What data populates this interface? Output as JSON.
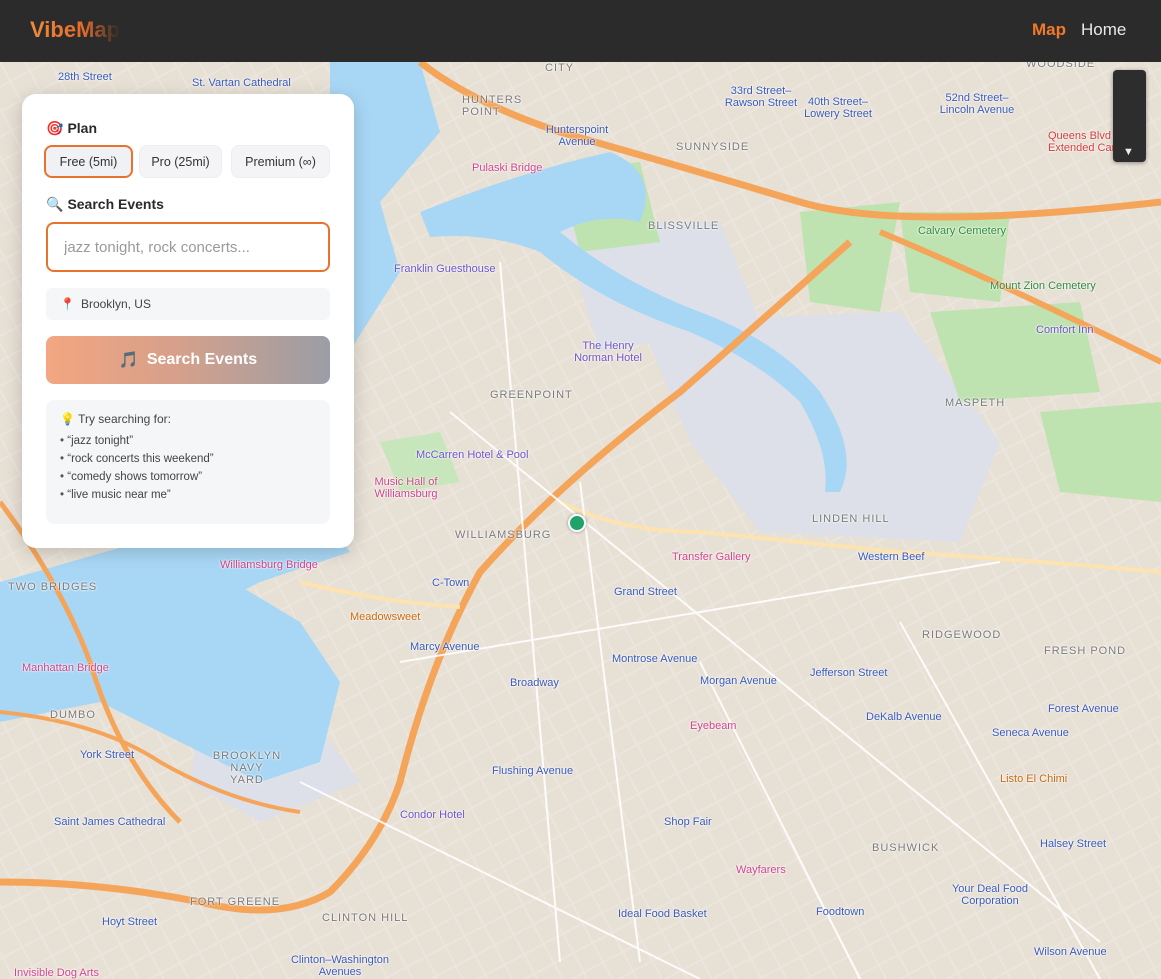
{
  "header": {
    "logo": "VibeMap",
    "nav": [
      {
        "label": "Map",
        "active": true
      },
      {
        "label": "Home",
        "active": false
      }
    ]
  },
  "panel": {
    "plan_title": "Plan",
    "plan_icon": "🎯",
    "plans": [
      {
        "label": "Free (5mi)",
        "selected": true
      },
      {
        "label": "Pro (25mi)",
        "selected": false
      },
      {
        "label": "Premium (∞)",
        "selected": false
      }
    ],
    "search_title": "Search Events",
    "search_icon": "🔍",
    "search_placeholder": "jazz tonight, rock concerts...",
    "location": "Brooklyn, US",
    "search_button": "Search Events",
    "search_button_icon": "🎵",
    "tips_title": "Try searching for:",
    "tips_icon": "💡",
    "tips": [
      "“jazz tonight”",
      "“rock concerts this weekend”",
      "“comedy shows tomorrow”",
      "“live music near me”"
    ]
  },
  "map": {
    "control_arrow": "▼",
    "labels": {
      "hunterspoint": "Hunterspoint Avenue",
      "pulaski": "Pulaski Bridge",
      "sunnyside": "SUNNYSIDE",
      "blissville": "BLISSVILLE",
      "calvary": "Calvary Cemetery",
      "mountzion": "Mount Zion Cemetery",
      "greenpoint": "GREENPOINT",
      "henry": "The Henry Norman Hotel",
      "franklin": "Franklin Guesthouse",
      "mccarren": "McCarren Hotel & Pool",
      "musichall": "Music Hall of Williamsburg",
      "williamsburg": "WILLIAMSBURG",
      "transfer": "Transfer Gallery",
      "grandst": "Grand Street",
      "linden": "LINDEN HILL",
      "westernbeef": "Western Beef",
      "maspeth": "MASPETH",
      "ridgewood": "RIDGEWOOD",
      "montrose": "Montrose Avenue",
      "morgan": "Morgan Avenue",
      "jefferson": "Jefferson Street",
      "dekalb": "DeKalb Avenue",
      "broadway": "Broadway",
      "marcy": "Marcy Avenue",
      "meadowsweet": "Meadowsweet",
      "ctown": "C-Town",
      "wburgbridge": "Williamsburg Bridge",
      "eyebeam": "Eyebeam",
      "flushingave": "Flushing Avenue",
      "bushwick": "BUSHWICK",
      "shopfair": "Shop Fair",
      "wayfarers": "Wayfarers",
      "yourdeal": "Your Deal Food Corporation",
      "ideal": "Ideal Food Basket",
      "foodtown": "Foodtown",
      "condor": "Condor Hotel",
      "navyyard": "BROOKLYN NAVY YARD",
      "fortgreene": "FORT GREENE",
      "clintonhill": "CLINTON HILL",
      "hoyt": "Hoyt Street",
      "york": "York Street",
      "dumbo": "DUMBO",
      "manhattanbridge": "Manhattan Bridge",
      "twobridges": "TWO BRIDGES",
      "stjames": "Saint James Cathedral",
      "clintonwash": "Clinton–Washington Avenues",
      "invisibledog": "Invisible Dog Arts",
      "seneca": "Seneca Avenue",
      "forestave": "Forest Avenue",
      "halsey": "Halsey Street",
      "wilson": "Wilson Avenue",
      "listo": "Listo El Chimi",
      "freshpond": "FRESH POND",
      "queensblvd": "Queens Blvd Extended Care",
      "comfortinn": "Comfort Inn",
      "rawson": "33rd Street–Rawson Street",
      "lowery": "40th Street–Lowery Street",
      "lincoln": "52nd Street–Lincoln Avenue",
      "vartan": "St. Vartan Cathedral",
      "street28": "28th Street",
      "woodside": "WOODSIDE",
      "city": "CITY",
      "hunterspointdist": "HUNTERS POINT"
    }
  }
}
